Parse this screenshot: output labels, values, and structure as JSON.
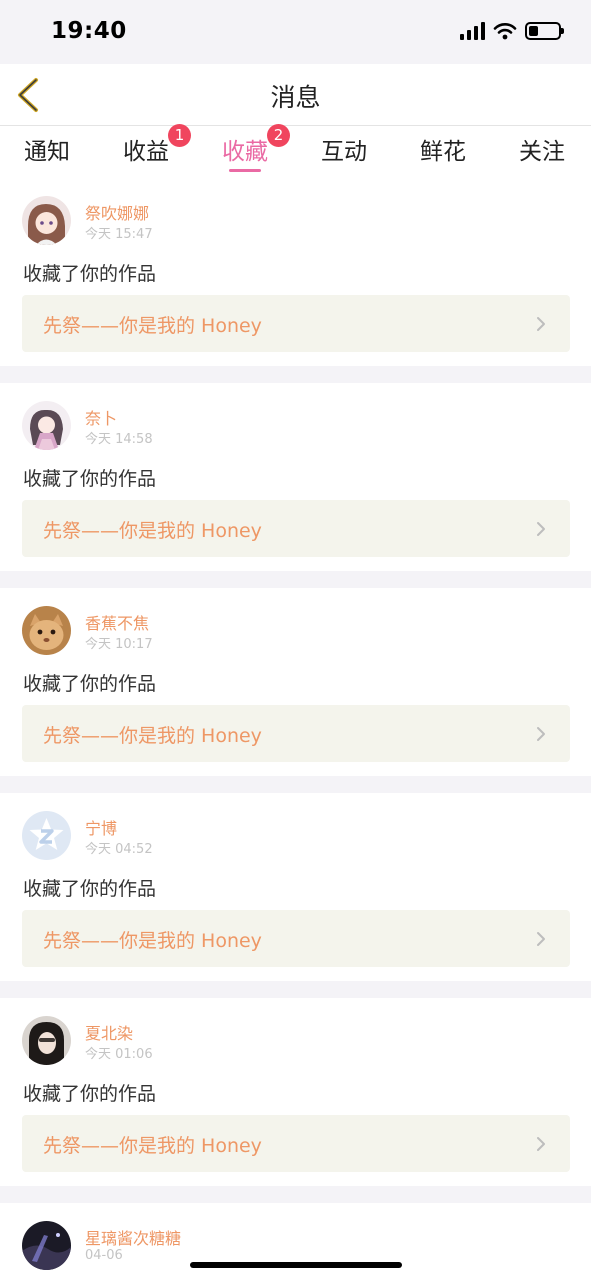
{
  "status_bar": {
    "time": "19:40"
  },
  "header": {
    "title": "消息"
  },
  "tabs": [
    {
      "label": "通知",
      "badge": ""
    },
    {
      "label": "收益",
      "badge": "1"
    },
    {
      "label": "收藏",
      "badge": "2"
    },
    {
      "label": "互动",
      "badge": ""
    },
    {
      "label": "鲜花",
      "badge": ""
    },
    {
      "label": "关注",
      "badge": ""
    }
  ],
  "active_tab": "收藏",
  "colors": {
    "accent": "#ea6aa4",
    "name": "#ee9765",
    "badge": "#f0455e"
  },
  "items": [
    {
      "user": "祭吹娜娜",
      "time": "今天 15:47",
      "action": "收藏了你的作品",
      "work": "先祭——你是我的 Honey"
    },
    {
      "user": "奈卜",
      "time": "今天 14:58",
      "action": "收藏了你的作品",
      "work": "先祭——你是我的 Honey"
    },
    {
      "user": "香蕉不焦",
      "time": "今天 10:17",
      "action": "收藏了你的作品",
      "work": "先祭——你是我的 Honey"
    },
    {
      "user": "宁博",
      "time": "今天 04:52",
      "action": "收藏了你的作品",
      "work": "先祭——你是我的 Honey"
    },
    {
      "user": "夏北染",
      "time": "今天 01:06",
      "action": "收藏了你的作品",
      "work": "先祭——你是我的 Honey"
    },
    {
      "user": "星璃酱次糖糖",
      "time": "04-06",
      "action": "",
      "work": ""
    }
  ]
}
